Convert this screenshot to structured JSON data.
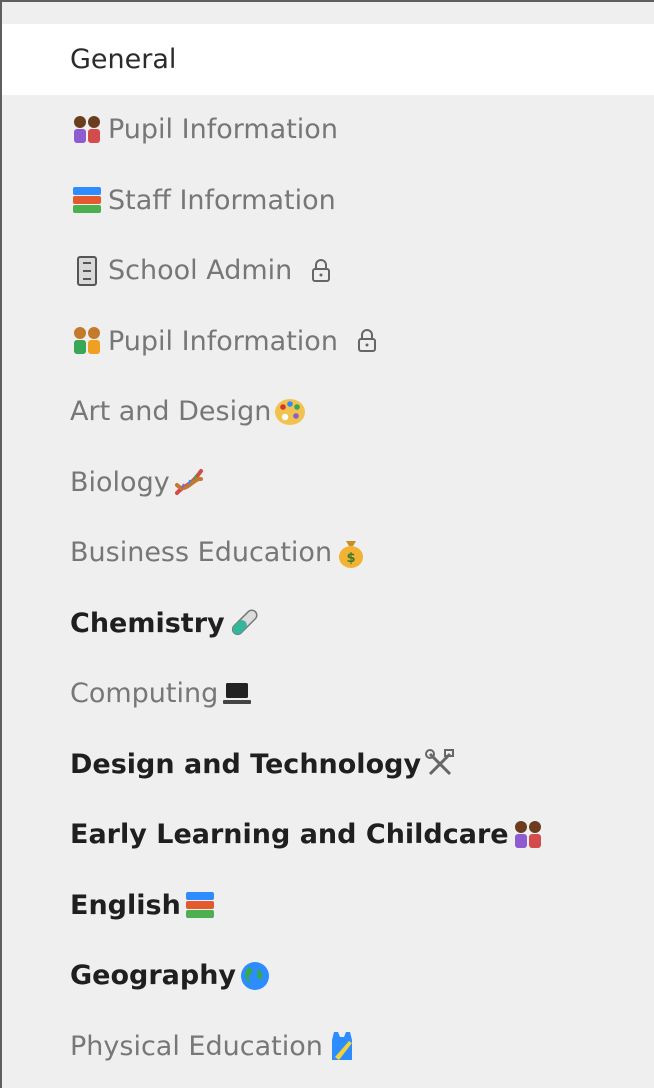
{
  "channels": [
    {
      "label": "General",
      "style": "selected",
      "lead_icon": "",
      "trail_icon": "",
      "locked": false
    },
    {
      "label": "Pupil Information",
      "style": "muted",
      "lead_icon": "girls-icon",
      "trail_icon": "",
      "locked": false
    },
    {
      "label": "Staff Information",
      "style": "muted",
      "lead_icon": "books-icon",
      "trail_icon": "",
      "locked": false
    },
    {
      "label": "School Admin",
      "style": "muted",
      "lead_icon": "filing-cabinet-icon",
      "trail_icon": "",
      "locked": true
    },
    {
      "label": "Pupil Information",
      "style": "muted",
      "lead_icon": "children-icon",
      "trail_icon": "",
      "locked": true
    },
    {
      "label": "Art and Design",
      "style": "muted",
      "lead_icon": "",
      "trail_icon": "palette-icon",
      "locked": false
    },
    {
      "label": "Biology",
      "style": "muted",
      "lead_icon": "",
      "trail_icon": "dna-icon",
      "locked": false
    },
    {
      "label": "Business Education",
      "style": "muted",
      "lead_icon": "",
      "trail_icon": "money-bag-icon",
      "locked": false
    },
    {
      "label": "Chemistry",
      "style": "unread",
      "lead_icon": "",
      "trail_icon": "test-tube-icon",
      "locked": false
    },
    {
      "label": "Computing",
      "style": "muted",
      "lead_icon": "",
      "trail_icon": "laptop-icon",
      "locked": false
    },
    {
      "label": "Design and Technology",
      "style": "unread",
      "lead_icon": "",
      "trail_icon": "tools-icon",
      "locked": false
    },
    {
      "label": "Early Learning and Childcare",
      "style": "unread",
      "lead_icon": "",
      "trail_icon": "girls-icon",
      "locked": false
    },
    {
      "label": "English",
      "style": "unread",
      "lead_icon": "",
      "trail_icon": "books-icon",
      "locked": false
    },
    {
      "label": "Geography",
      "style": "unread",
      "lead_icon": "",
      "trail_icon": "globe-icon",
      "locked": false
    },
    {
      "label": "Physical Education",
      "style": "muted",
      "lead_icon": "",
      "trail_icon": "vest-icon",
      "locked": false
    }
  ],
  "colors": {
    "sidebar_bg": "#efefef",
    "selected_bg": "#ffffff",
    "muted_text": "#777777",
    "bold_text": "#1f1f1f"
  }
}
